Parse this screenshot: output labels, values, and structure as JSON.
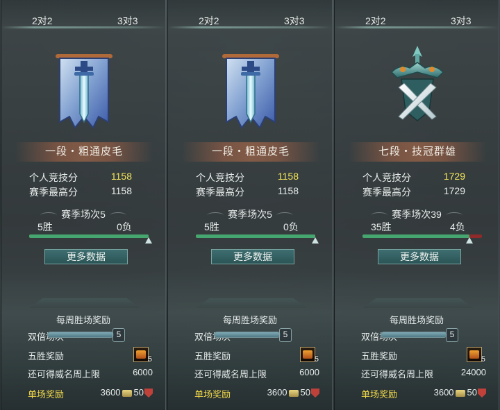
{
  "panels": [
    {
      "mode_left": "2对2",
      "mode_right": "3对3",
      "rank_icon": "banner-sword-icon",
      "rank_title": "一段・粗通皮毛",
      "score_label": "个人竞技分",
      "score_value": "1158",
      "season_best_label": "赛季最高分",
      "season_best_value": "1158",
      "season_matches": "赛季场次5",
      "wins": "5胜",
      "losses": "0负",
      "win_fraction": 1.0,
      "more_button": "更多数据",
      "weekly_title": "每周胜场奖励",
      "double_label": "双倍场次",
      "double_cap": "5",
      "five_win_label": "五胜奖励",
      "chest_count": "5",
      "fame_label": "还可得威名周上限",
      "fame_value": "6000",
      "single_label": "单场奖励",
      "coin_value": "3600",
      "shield_value": "50"
    },
    {
      "mode_left": "2对2",
      "mode_right": "3对3",
      "rank_icon": "banner-sword-icon",
      "rank_title": "一段・粗通皮毛",
      "score_label": "个人竞技分",
      "score_value": "1158",
      "season_best_label": "赛季最高分",
      "season_best_value": "1158",
      "season_matches": "赛季场次5",
      "wins": "5胜",
      "losses": "0负",
      "win_fraction": 1.0,
      "more_button": "更多数据",
      "weekly_title": "每周胜场奖励",
      "double_label": "双倍场次",
      "double_cap": "5",
      "five_win_label": "五胜奖励",
      "chest_count": "5",
      "fame_label": "还可得威名周上限",
      "fame_value": "6000",
      "single_label": "单场奖励",
      "coin_value": "3600",
      "shield_value": "50"
    },
    {
      "mode_left": "2对2",
      "mode_right": "3对3",
      "rank_icon": "crossed-blades-crest-icon",
      "rank_title": "七段・技冠群雄",
      "score_label": "个人竞技分",
      "score_value": "1729",
      "season_best_label": "赛季最高分",
      "season_best_value": "1729",
      "season_matches": "赛季场次39",
      "wins": "35胜",
      "losses": "4负",
      "win_fraction": 0.897,
      "more_button": "更多数据",
      "weekly_title": "每周胜场奖励",
      "double_label": "双倍场次",
      "double_cap": "5",
      "five_win_label": "五胜奖励",
      "chest_count": "5",
      "fame_label": "还可得威名周上限",
      "fame_value": "24000",
      "single_label": "单场奖励",
      "coin_value": "3600",
      "shield_value": "50"
    }
  ],
  "colors": {
    "score_highlight": "#f5e65a",
    "win_bar": "#46a66f",
    "loss_bar": "#8f2a2a",
    "single_reward_label": "#f2d94a"
  }
}
